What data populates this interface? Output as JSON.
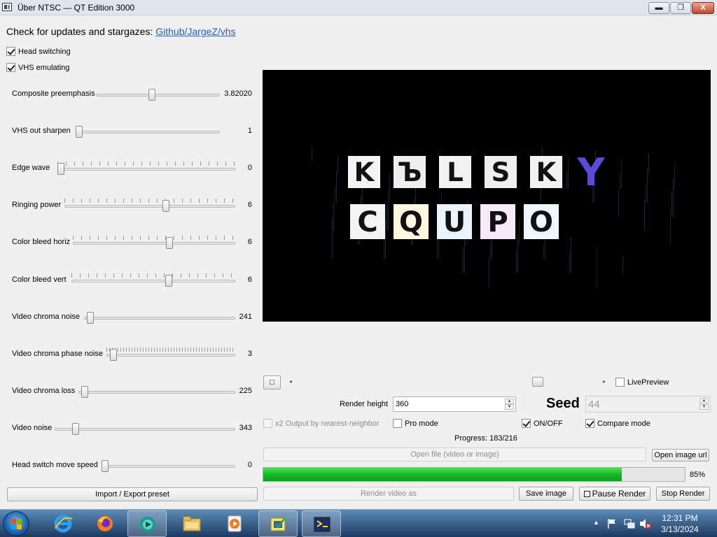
{
  "window": {
    "title": "Über NTSC — QT Edition 3000",
    "minimize_glyph": "▬",
    "maximize_glyph": "❐",
    "close_glyph": "X"
  },
  "header": {
    "text": "Check for updates and stargazes:",
    "link": "Github/JargeZ/vhs"
  },
  "checkboxes": {
    "head_switching": {
      "label": "Head switching",
      "checked": true
    },
    "vhs_emulating": {
      "label": "VHS emulating",
      "checked": true
    }
  },
  "sliders": [
    {
      "label": "Composite preemphasis",
      "value": "3.82020",
      "level": 0.45,
      "ticks": false
    },
    {
      "label": "VHS out sharpen",
      "value": "1",
      "level": 0.0,
      "ticks": false
    },
    {
      "label": "Edge wave",
      "value": "0",
      "level": 0.0,
      "ticks": true
    },
    {
      "label": "Ringing power",
      "value": "6",
      "level": 0.6,
      "ticks": true
    },
    {
      "label": "Color bleed horiz",
      "value": "6",
      "level": 0.6,
      "ticks": true
    },
    {
      "label": "Color bleed vert",
      "value": "6",
      "level": 0.6,
      "ticks": true
    },
    {
      "label": "Video chroma noise",
      "value": "241",
      "level": 0.02,
      "ticks": false
    },
    {
      "label": "Video chroma phase noise",
      "value": "3",
      "level": 0.03,
      "ticks": true
    },
    {
      "label": "Video chroma loss",
      "value": "225",
      "level": 0.02,
      "ticks": false
    },
    {
      "label": "Video noise",
      "value": "343",
      "level": 0.1,
      "ticks": false
    },
    {
      "label": "Head switch move speed",
      "value": "0",
      "level": 0.0,
      "ticks": false
    }
  ],
  "preview": {
    "row1": [
      "K",
      "Ъ",
      "L",
      "S",
      "K",
      "Y"
    ],
    "row2": [
      "C",
      "Q",
      "U",
      "P",
      "O"
    ]
  },
  "timeline": {
    "position": 0.78,
    "live_preview_label": "LivePreview",
    "live_preview_checked": false,
    "stop_glyph": "□"
  },
  "render": {
    "height_label": "Render height",
    "height_value": "360",
    "seed_label": "Seed",
    "seed_value": "44"
  },
  "options": {
    "x2_output": {
      "label": "x2 Output by nearest-neighbor",
      "checked": false,
      "enabled": false
    },
    "pro_mode": {
      "label": "Pro mode",
      "checked": false
    },
    "on_off": {
      "label": "ON/OFF",
      "checked": true
    },
    "compare_mode": {
      "label": "Compare mode",
      "checked": true
    }
  },
  "progress": {
    "text": "Progress: 183/216",
    "fraction": 0.85,
    "percent_label": "85%"
  },
  "buttons": {
    "open_file": "Open file (video or image)",
    "open_image_url": "Open image url",
    "import_export_preset": "Import / Export preset",
    "render_video_as": "Render video as",
    "save_image": "Save image",
    "pause_render": "Pause Render",
    "stop_render": "Stop Render"
  },
  "taskbar": {
    "clock_time": "12:31 PM",
    "clock_date": "3/13/2024"
  },
  "colors": {
    "accent_link": "#2a5db0",
    "progress_green": "#14b625",
    "taskbar": "#1c3a62"
  }
}
